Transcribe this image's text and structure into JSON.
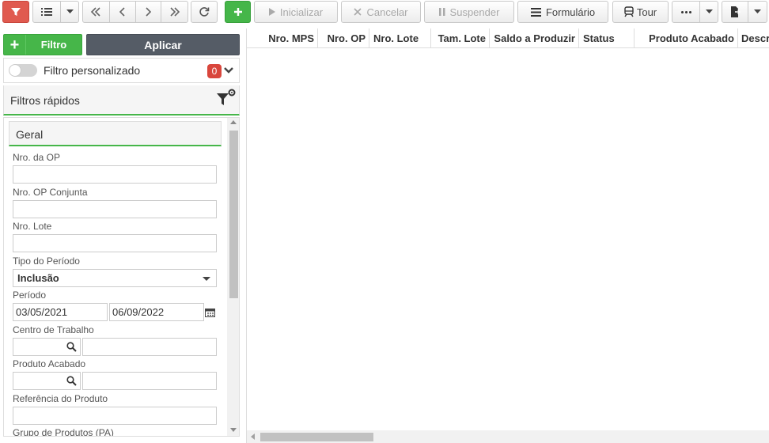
{
  "toolbar": {
    "novo_icon": "plus-icon",
    "iniciar": "Inicializar",
    "cancelar": "Cancelar",
    "suspender": "Suspender",
    "formulario": "Formulário",
    "tour": "Tour",
    "colors": {
      "filter_button": "#e05a4f",
      "new_button": "#45b649"
    }
  },
  "left": {
    "filtro_button": "Filtro",
    "aplicar_button": "Aplicar",
    "custom_filter_label": "Filtro personalizado",
    "custom_filter_count": "0",
    "quick_filters_title": "Filtros rápidos",
    "section_title": "Geral",
    "fields": {
      "nro_op": {
        "label": "Nro. da OP",
        "value": ""
      },
      "nro_op_conjunta": {
        "label": "Nro. OP Conjunta",
        "value": ""
      },
      "nro_lote": {
        "label": "Nro. Lote",
        "value": ""
      },
      "tipo_periodo": {
        "label": "Tipo do Período",
        "value": "Inclusão"
      },
      "periodo": {
        "label": "Período",
        "start": "03/05/2021",
        "end": "06/09/2022"
      },
      "centro_trabalho": {
        "label": "Centro de Trabalho",
        "code": "",
        "desc": ""
      },
      "produto_acabado": {
        "label": "Produto Acabado",
        "code": "",
        "desc": ""
      },
      "referencia_produto": {
        "label": "Referência do Produto",
        "value": ""
      },
      "grupo_produtos": {
        "label": "Grupo de Produtos (PA)"
      }
    },
    "colors": {
      "accent": "#46b649",
      "aplicar_bg": "#555c66",
      "badge": "#d9463c"
    }
  },
  "grid": {
    "columns": [
      "Nro. MPS",
      "Nro. OP",
      "Nro. Lote",
      "Tam. Lote",
      "Saldo a Produzir",
      "Status",
      "Produto Acabado",
      "Descr"
    ],
    "rows": []
  }
}
